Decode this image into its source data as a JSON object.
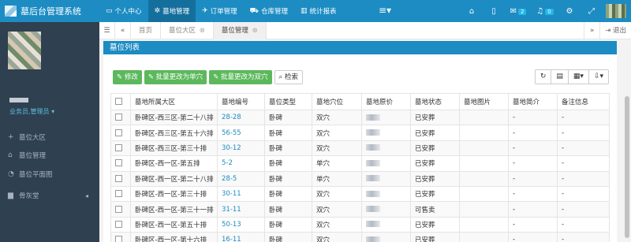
{
  "app": {
    "title": "墓后台管理系统"
  },
  "nav": [
    {
      "icon": "▭",
      "label": "个人中心",
      "active": false
    },
    {
      "icon": "✲",
      "label": "墓地管理",
      "active": true
    },
    {
      "icon": "✈",
      "label": "订单管理",
      "active": false
    },
    {
      "icon": "⛟",
      "label": "仓库管理",
      "active": false
    },
    {
      "icon": "▥",
      "label": "统计报表",
      "active": false
    }
  ],
  "topright": {
    "mail_count": "2",
    "bell_count": "0"
  },
  "sidebar": {
    "role": "业务员,管理员",
    "items": [
      {
        "icon": "+",
        "label": "墓位大区"
      },
      {
        "icon": "⌂",
        "label": "墓位管理"
      },
      {
        "icon": "◔",
        "label": "墓位平面图"
      },
      {
        "icon": "▆",
        "label": "骨灰堂"
      }
    ]
  },
  "tabs": {
    "items": [
      {
        "label": "首页"
      },
      {
        "label": "墓位大区"
      },
      {
        "label": "墓位管理"
      }
    ],
    "logout": "退出"
  },
  "panel": {
    "title": "墓位列表"
  },
  "toolbar": {
    "edit": "修改",
    "batch_single": "批量更改为单穴",
    "batch_double": "批量更改为双穴",
    "search": "检索"
  },
  "table": {
    "headers": [
      "墓地所属大区",
      "墓地编号",
      "墓位类型",
      "墓地穴位",
      "墓地原价",
      "墓地状态",
      "墓地图片",
      "墓地简介",
      "备注信息"
    ],
    "rows": [
      [
        "卧碑区-西三区-第二十八排",
        "28-28",
        "卧碑",
        "双穴",
        "",
        "已安葬",
        "",
        "-",
        "-"
      ],
      [
        "卧碑区-西三区-第五十六排",
        "56-55",
        "卧碑",
        "双穴",
        "",
        "已安葬",
        "",
        "-",
        "-"
      ],
      [
        "卧碑区-西三区-第三十排",
        "30-12",
        "卧碑",
        "双穴",
        "",
        "已安葬",
        "",
        "-",
        "-"
      ],
      [
        "卧碑区-西一区-第五排",
        "5-2",
        "卧碑",
        "单穴",
        "",
        "已安葬",
        "",
        "-",
        "-"
      ],
      [
        "卧碑区-西一区-第二十八排",
        "28-5",
        "卧碑",
        "单穴",
        "",
        "已安葬",
        "",
        "-",
        "-"
      ],
      [
        "卧碑区-西一区-第三十排",
        "30-11",
        "卧碑",
        "双穴",
        "",
        "已安葬",
        "",
        "-",
        "-"
      ],
      [
        "卧碑区-西一区-第三十一排",
        "31-11",
        "卧碑",
        "双穴",
        "",
        "可售卖",
        "",
        "-",
        "-"
      ],
      [
        "卧碑区-西一区-第五十排",
        "50-13",
        "卧碑",
        "双穴",
        "",
        "已安葬",
        "",
        "-",
        "-"
      ],
      [
        "卧碑区-西一区-第十六排",
        "16-11",
        "卧碑",
        "双穴",
        "",
        "已安葬",
        "",
        "-",
        "-"
      ]
    ]
  }
}
